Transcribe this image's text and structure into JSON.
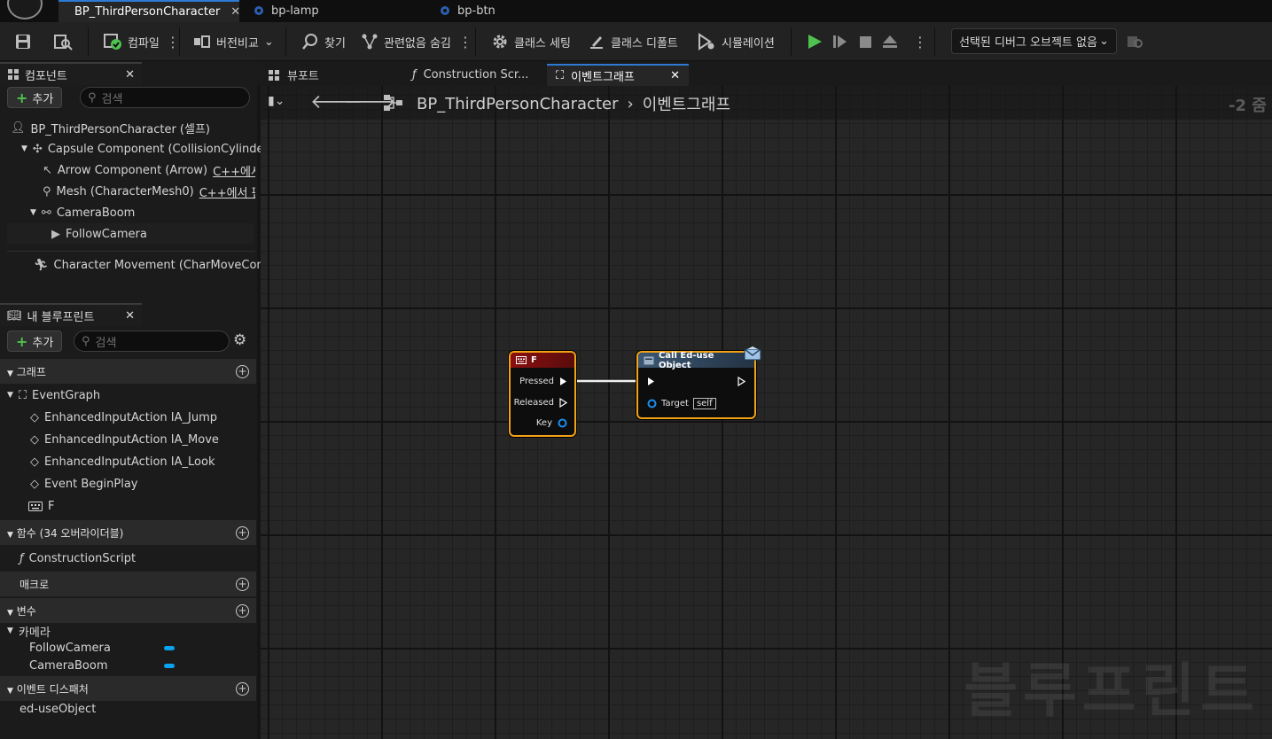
{
  "doc_tabs": [
    {
      "label": "BP_ThirdPersonCharacter",
      "active": true
    },
    {
      "label": "bp-lamp",
      "active": false
    },
    {
      "label": "bp-btn",
      "active": false
    }
  ],
  "toolbar": {
    "compile": "컴파일",
    "diff": "버전비교",
    "find": "찾기",
    "hide_unrelated": "관련없음 숨김",
    "class_settings": "클래스 세팅",
    "class_defaults": "클래스 디폴트",
    "simulation": "시뮬레이션",
    "debug_object": "선택된 디버그 오브젝트 없음"
  },
  "components": {
    "tab_label": "컴포넌트",
    "add_label": "추가",
    "search_placeholder": "검색",
    "root": "BP_ThirdPersonCharacter (셀프)",
    "items": [
      {
        "label": "Capsule Component (CollisionCylinder)",
        "note": ""
      },
      {
        "label": "Arrow Component (Arrow)",
        "note": "C++에서 편"
      },
      {
        "label": "Mesh (CharacterMesh0)",
        "note": "C++에서 편집"
      },
      {
        "label": "CameraBoom",
        "note": ""
      },
      {
        "label": "FollowCamera",
        "note": ""
      },
      {
        "label": "Character Movement (CharMoveComp)",
        "note": ""
      }
    ]
  },
  "my_blueprint": {
    "tab_label": "내 블루프린트",
    "add_label": "추가",
    "search_placeholder": "검색",
    "sections": {
      "graphs": "그래프",
      "functions": "함수 (34 오버라이더블)",
      "macros": "매크로",
      "variables": "변수",
      "dispatchers": "이벤트 디스패처"
    },
    "graph_root": "EventGraph",
    "graph_items": [
      "EnhancedInputAction IA_Jump",
      "EnhancedInputAction IA_Move",
      "EnhancedInputAction IA_Look",
      "Event BeginPlay",
      "F"
    ],
    "function_items": [
      "ConstructionScript"
    ],
    "variable_category": "카메라",
    "variable_items": [
      "FollowCamera",
      "CameraBoom"
    ],
    "dispatcher_items": [
      "ed-useObject"
    ]
  },
  "graph_tabs": [
    {
      "label": "뷰포트",
      "active": false
    },
    {
      "label": "Construction Scr...",
      "active": false
    },
    {
      "label": "이벤트그래프",
      "active": true
    }
  ],
  "graph": {
    "breadcrumb_root": "BP_ThirdPersonCharacter",
    "breadcrumb_leaf": "이벤트그래프",
    "zoom": "-2 줌",
    "watermark": "블루프린트"
  },
  "nodes": {
    "key_event": {
      "title": "F",
      "pressed": "Pressed",
      "released": "Released",
      "key": "Key",
      "header_color": "#8b1010"
    },
    "call": {
      "title": "Call Ed-use Object",
      "target": "Target",
      "target_value": "self",
      "header_color": "#3c5873"
    }
  },
  "colors": {
    "accent": "#2d7ad4",
    "node_border": "#f2a216",
    "var_pin": "#0aa3f0",
    "play_green": "#4fc24f"
  }
}
